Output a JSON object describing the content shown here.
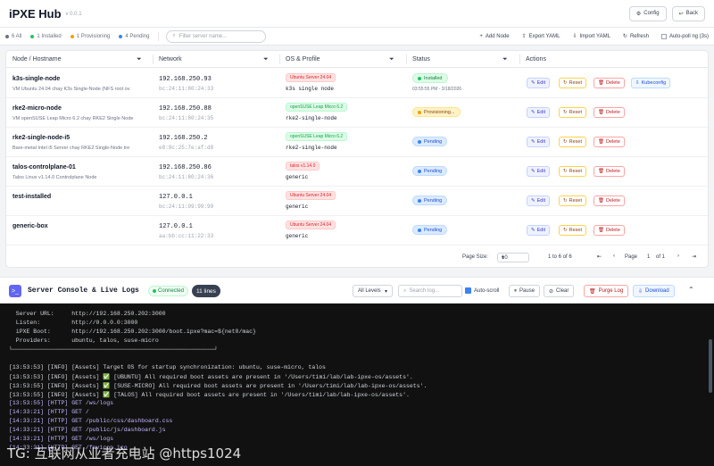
{
  "header": {
    "title": "iPXE Hub",
    "version": "v 0.0.1",
    "config_label": "Config",
    "back_label": "Back"
  },
  "stats": [
    {
      "label": "6 All",
      "color": "#6b7280"
    },
    {
      "label": "1 Installed",
      "color": "#22c55e"
    },
    {
      "label": "1 Provisioning",
      "color": "#f59e0b"
    },
    {
      "label": "4 Pending",
      "color": "#3b82f6"
    }
  ],
  "search": {
    "placeholder": "Filter server name..."
  },
  "toolbar": {
    "add_node": "Add Node",
    "export_yaml": "Export YAML",
    "import_yaml": "Import YAML",
    "refresh": "Refresh",
    "auto_poll": "Auto-poll ng (3s)"
  },
  "table": {
    "headers": {
      "node": "Node / Hostname",
      "network": "Network",
      "os": "OS & Profile",
      "status": "Status",
      "actions": "Actions"
    },
    "rows": [
      {
        "name": "k3s-single-node",
        "desc": "VM Ubuntu 24.04 chay K3s Single-Node (NFS root ov",
        "ip": "192.168.250.93",
        "mac": "bc:24:11:80:24:33",
        "os": "Ubuntu Server 24.04",
        "os_color": "red",
        "profile": "k3s single node",
        "status": "Installed",
        "status_type": "ins",
        "status_time": "03:55:55 PM - 3/18/2026",
        "kube": true
      },
      {
        "name": "rke2-micro-node",
        "desc": "VM openSUSE Leap Micro 6.2 chay RKE2 Single Node",
        "ip": "192.168.250.88",
        "mac": "bc:24:11:80:24:35",
        "os": "openSUSE Leap Micro 6.2",
        "os_color": "grn",
        "profile": "rke2-single-node",
        "status": "Provisioning...",
        "status_type": "prov",
        "status_time": "",
        "kube": false
      },
      {
        "name": "rke2-single-node-i5",
        "desc": "Bare-metal Intel i5 Server chay RKE2 Single-Node tre",
        "ip": "192.168.250.2",
        "mac": "e8:9c:25:7e:af:d8",
        "os": "openSUSE Leap Micro 6.2",
        "os_color": "grn",
        "profile": "rke2-single-node",
        "status": "Pending",
        "status_type": "pend",
        "status_time": "",
        "kube": false
      },
      {
        "name": "talos-controlplane-01",
        "desc": "Talos Linux v1.14.0 Controlplane Node",
        "ip": "192.168.250.86",
        "mac": "bc:24:11:80:24:36",
        "os": "talos v1.14.0",
        "os_color": "red",
        "profile": "generic",
        "status": "Pending",
        "status_type": "pend",
        "status_time": "",
        "kube": false
      },
      {
        "name": "test-installed",
        "desc": "",
        "ip": "127.0.0.1",
        "mac": "bc:24:11:99:99:99",
        "os": "Ubuntu Server 24.04",
        "os_color": "red",
        "profile": "generic",
        "status": "Pending",
        "status_type": "pend",
        "status_time": "",
        "kube": false
      },
      {
        "name": "generic-box",
        "desc": "",
        "ip": "127.0.0.1",
        "mac": "aa:bb:cc:11:22:33",
        "os": "Ubuntu Server 24.04",
        "os_color": "red",
        "profile": "generic",
        "status": "Pending",
        "status_type": "pend",
        "status_time": "",
        "kube": false
      }
    ],
    "action_labels": {
      "edit": "Edit",
      "reset": "Reset",
      "delete": "Delete",
      "kube": "Kubeconfig"
    }
  },
  "pagination": {
    "page_size_label": "Page Size:",
    "page_size": "10",
    "range": "1 to 6 of 6",
    "page_label": "Page",
    "page": "1",
    "of_label": "of 1"
  },
  "console": {
    "title": "Server Console & Live Logs",
    "connected": "Connected",
    "lines_badge": "11 lines",
    "level": "All Levels",
    "filter_placeholder": "Search log...",
    "autoscroll": "Auto-scroll",
    "pause": "Pause",
    "clear": "Clear",
    "purge": "Purge Log",
    "download": "Download",
    "lines": [
      "  Server URL:     http://192.168.250.202:3000",
      "  Listen:         http://0.0.0.0:3000",
      "  iPXE Boot:      http://192.168.250.202:3000/boot.ipxe?mac=${net0/mac}",
      "  Providers:      ubuntu, talos, suse-micro",
      "└──────────────────────────────────────────────────────────┘",
      "",
      "[13:53:53] [INFO] [Assets] Target OS for startup synchronization: ubuntu, suse-micro, talos",
      "[13:53:53] [INFO] [Assets] ✅ [UBUNTU] All required boot assets are present in '/Users/timi/lab/lab-ipxe-os/assets'.",
      "[13:53:55] [INFO] [Assets] ✅ [SUSE-MICRO] All required boot assets are present in '/Users/timi/lab/lab-ipxe-os/assets'.",
      "[13:53:55] [INFO] [Assets] ✅ [TALOS] All required boot assets are present in '/Users/timi/lab/lab-ipxe-os/assets'.",
      "[13:53:55] [HTTP] GET /ws/logs",
      "[14:33:21] [HTTP] GET /",
      "[14:33:21] [HTTP] GET /public/css/dashboard.css",
      "[14:33:21] [HTTP] GET /public/js/dashboard.js",
      "[14:33:21] [HTTP] GET /ws/logs",
      "[14:33:21] [HTTP] GET /favicon.ico"
    ]
  },
  "watermark": "TG: 互联网从业者充电站 @https1024"
}
